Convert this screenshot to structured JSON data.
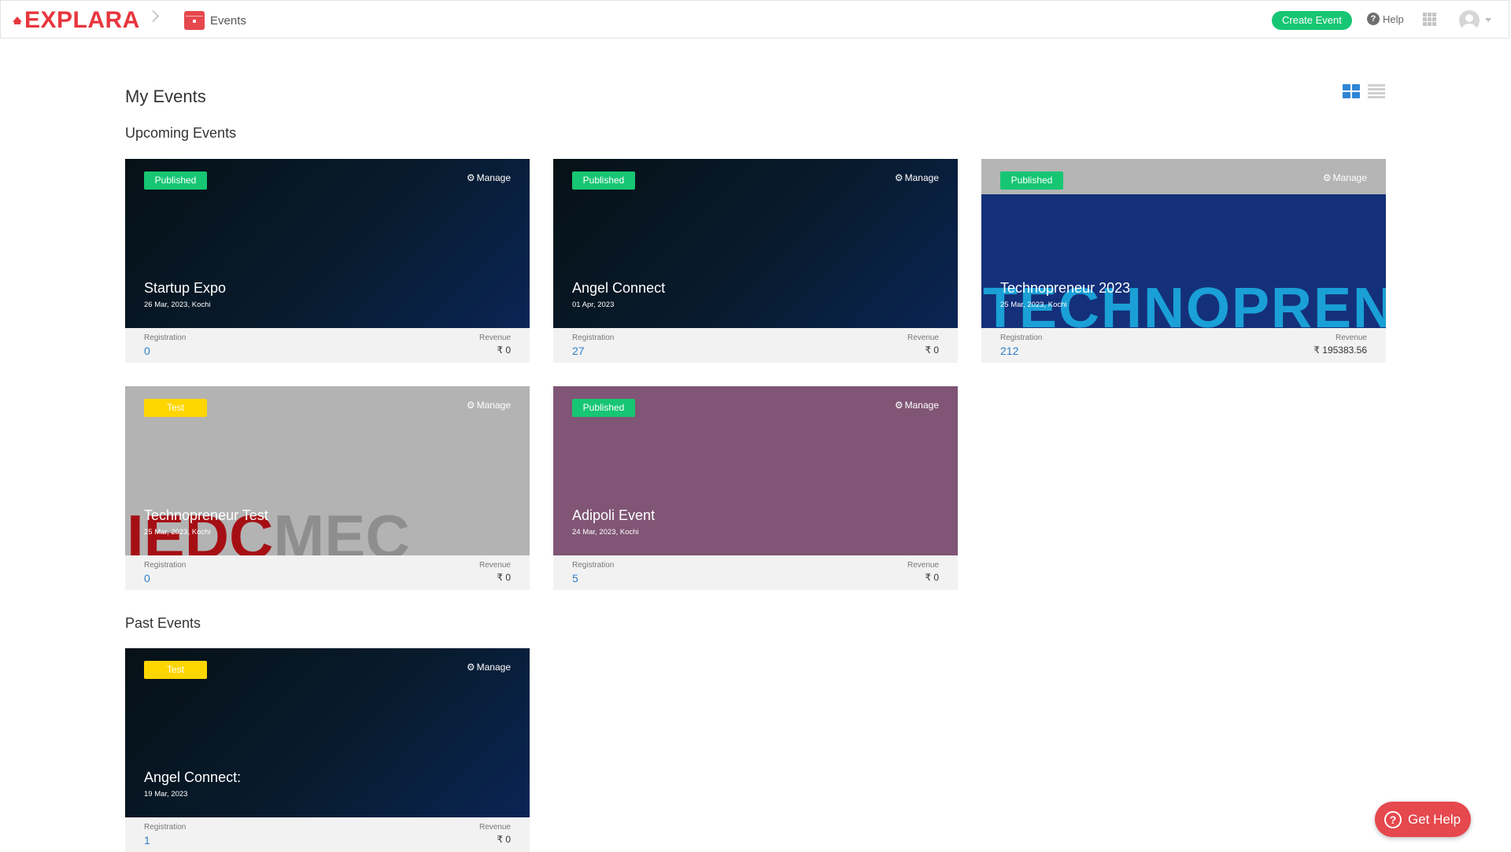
{
  "header": {
    "brand": "EXPLARA",
    "breadcrumb": "Events",
    "create_button": "Create Event",
    "help_label": "Help",
    "icons": [
      "explara-logo",
      "calendar-icon",
      "help-icon",
      "apps-grid-icon",
      "user-avatar",
      "chevron-down-icon"
    ]
  },
  "page": {
    "title": "My Events",
    "upcoming_title": "Upcoming Events",
    "past_title": "Past Events"
  },
  "upcoming": [
    {
      "status": "Published",
      "manage": "Manage",
      "name": "Startup Expo",
      "date": "26 Mar, 2023, Kochi",
      "reg_label": "Registration",
      "registrations": "0",
      "rev_label": "Revenue",
      "revenue": "₹ 0"
    },
    {
      "status": "Published",
      "manage": "Manage",
      "name": "Angel Connect",
      "date": "01 Apr, 2023",
      "reg_label": "Registration",
      "registrations": "27",
      "rev_label": "Revenue",
      "revenue": "₹ 0"
    },
    {
      "status": "Published",
      "manage": "Manage",
      "name": "Technopreneur 2023",
      "date": "25 Mar, 2023, Kochi",
      "reg_label": "Registration",
      "registrations": "212",
      "rev_label": "Revenue",
      "revenue": "₹ 195383.56",
      "banner_text": "TECHNOPRENEUR"
    },
    {
      "status": "Test",
      "manage": "Manage",
      "name": "Technopreneur Test",
      "date": "25 Mar, 2023, Kochi",
      "reg_label": "Registration",
      "registrations": "0",
      "rev_label": "Revenue",
      "revenue": "₹ 0",
      "banner_text_a": "IEDC",
      "banner_text_b": "MEC"
    },
    {
      "status": "Published",
      "manage": "Manage",
      "name": "Adipoli Event",
      "date": "24 Mar, 2023, Kochi",
      "reg_label": "Registration",
      "registrations": "5",
      "rev_label": "Revenue",
      "revenue": "₹ 0"
    }
  ],
  "past": [
    {
      "status": "Test",
      "manage": "Manage",
      "name": "Angel Connect:",
      "date": "19 Mar, 2023",
      "reg_label": "Registration",
      "registrations": "1",
      "rev_label": "Revenue",
      "revenue": "₹ 0"
    }
  ],
  "help_widget": {
    "label": "Get Help"
  },
  "colors": {
    "brand_red": "#e8363d",
    "published_green": "#17c673",
    "test_yellow": "#ffd500",
    "link_blue": "#2f7fc8"
  }
}
